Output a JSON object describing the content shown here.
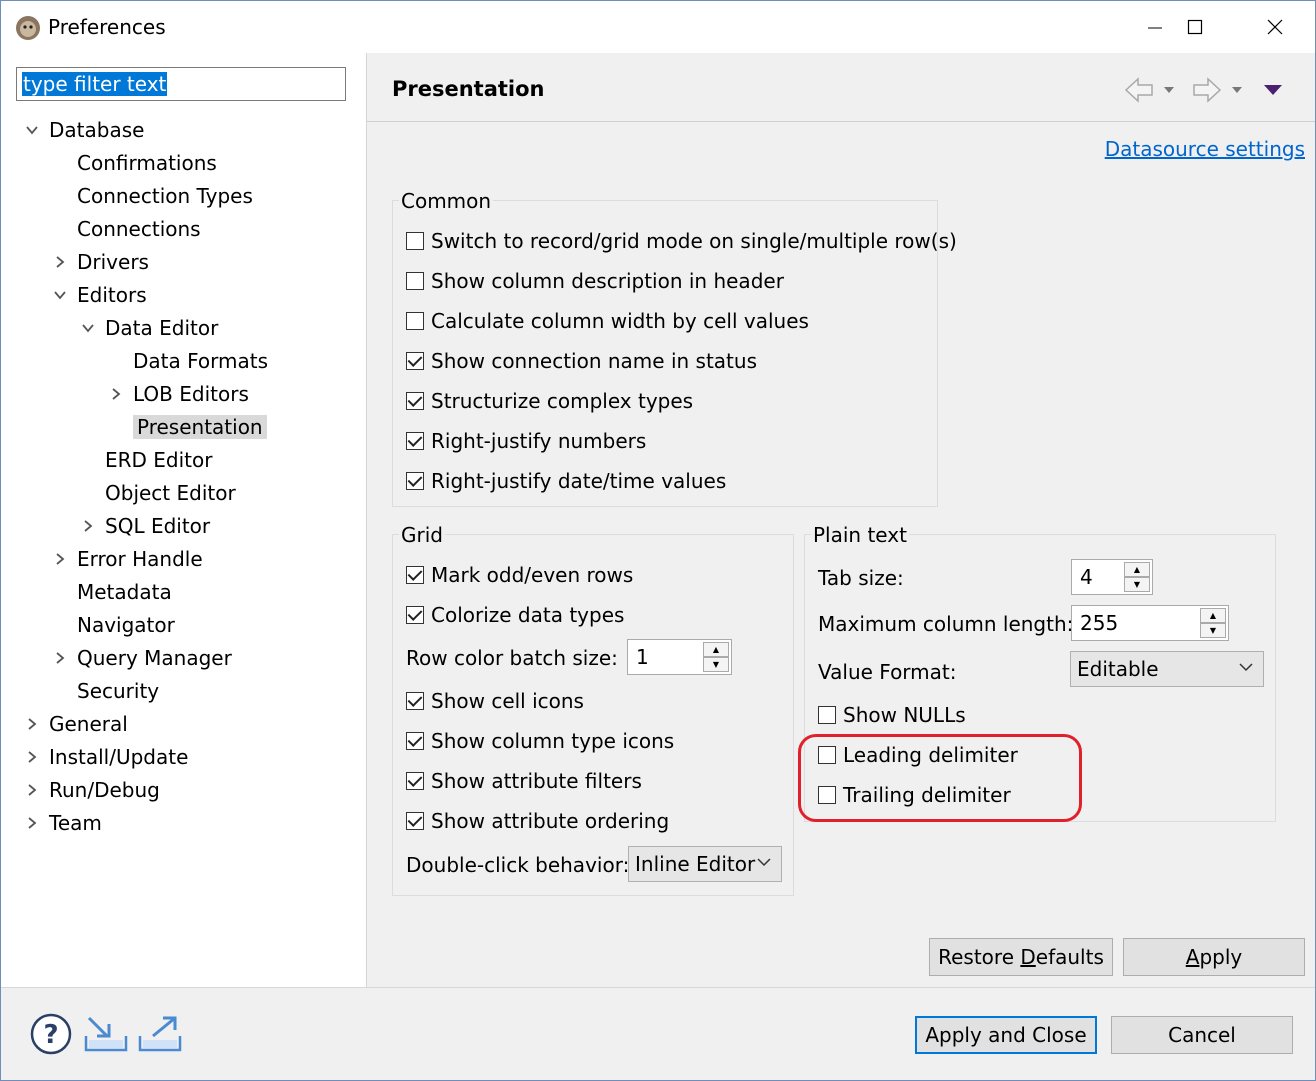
{
  "window": {
    "title": "Preferences"
  },
  "filter": {
    "placeholder": "type filter text"
  },
  "tree": [
    {
      "label": "Database",
      "indent": 0,
      "expanded": true
    },
    {
      "label": "Confirmations",
      "indent": 1,
      "leaf": true
    },
    {
      "label": "Connection Types",
      "indent": 1,
      "leaf": true
    },
    {
      "label": "Connections",
      "indent": 1,
      "leaf": true
    },
    {
      "label": "Drivers",
      "indent": 1
    },
    {
      "label": "Editors",
      "indent": 1,
      "expanded": true
    },
    {
      "label": "Data Editor",
      "indent": 2,
      "expanded": true
    },
    {
      "label": "Data Formats",
      "indent": 3,
      "leaf": true
    },
    {
      "label": "LOB Editors",
      "indent": 3
    },
    {
      "label": "Presentation",
      "indent": 3,
      "leaf": true,
      "selected": true
    },
    {
      "label": "ERD Editor",
      "indent": 2,
      "leaf": true
    },
    {
      "label": "Object Editor",
      "indent": 2,
      "leaf": true
    },
    {
      "label": "SQL Editor",
      "indent": 2
    },
    {
      "label": "Error Handle",
      "indent": 1
    },
    {
      "label": "Metadata",
      "indent": 1,
      "leaf": true
    },
    {
      "label": "Navigator",
      "indent": 1,
      "leaf": true
    },
    {
      "label": "Query Manager",
      "indent": 1
    },
    {
      "label": "Security",
      "indent": 1,
      "leaf": true
    },
    {
      "label": "General",
      "indent": 0
    },
    {
      "label": "Install/Update",
      "indent": 0
    },
    {
      "label": "Run/Debug",
      "indent": 0
    },
    {
      "label": "Team",
      "indent": 0
    }
  ],
  "page": {
    "title": "Presentation",
    "datasource_link": "Datasource settings"
  },
  "common": {
    "label": "Common",
    "items": [
      {
        "label": "Switch to record/grid mode on single/multiple row(s)",
        "checked": false
      },
      {
        "label": "Show column description in header",
        "checked": false
      },
      {
        "label": "Calculate column width by cell values",
        "checked": false
      },
      {
        "label": "Show connection name in status",
        "checked": true
      },
      {
        "label": "Structurize complex types",
        "checked": true
      },
      {
        "label": "Right-justify numbers",
        "checked": true
      },
      {
        "label": "Right-justify date/time values",
        "checked": true
      }
    ]
  },
  "grid": {
    "label": "Grid",
    "mark_odd_even": {
      "label": "Mark odd/even rows",
      "checked": true
    },
    "colorize": {
      "label": "Colorize data types",
      "checked": true
    },
    "row_color_batch_label": "Row color batch size:",
    "row_color_batch_value": "1",
    "items": [
      {
        "label": "Show cell icons",
        "checked": true
      },
      {
        "label": "Show column type icons",
        "checked": true
      },
      {
        "label": "Show attribute filters",
        "checked": true
      },
      {
        "label": "Show attribute ordering",
        "checked": true
      }
    ],
    "double_click_label": "Double-click behavior:",
    "double_click_value": "Inline Editor"
  },
  "plain_text": {
    "label": "Plain text",
    "tab_size_label": "Tab size:",
    "tab_size_value": "4",
    "max_col_label": "Maximum column length:",
    "max_col_value": "255",
    "value_format_label": "Value Format:",
    "value_format_value": "Editable",
    "items": [
      {
        "label": "Show NULLs",
        "checked": false
      },
      {
        "label": "Leading delimiter",
        "checked": false
      },
      {
        "label": "Trailing delimiter",
        "checked": false
      }
    ]
  },
  "buttons": {
    "restore_pre": "Restore ",
    "restore_u": "D",
    "restore_post": "efaults",
    "apply_u": "A",
    "apply_post": "pply",
    "apply_close": "Apply and Close",
    "cancel": "Cancel"
  },
  "colors": {
    "accent": "#0078d7",
    "highlight": "#e0202a",
    "link": "#0066cc"
  }
}
